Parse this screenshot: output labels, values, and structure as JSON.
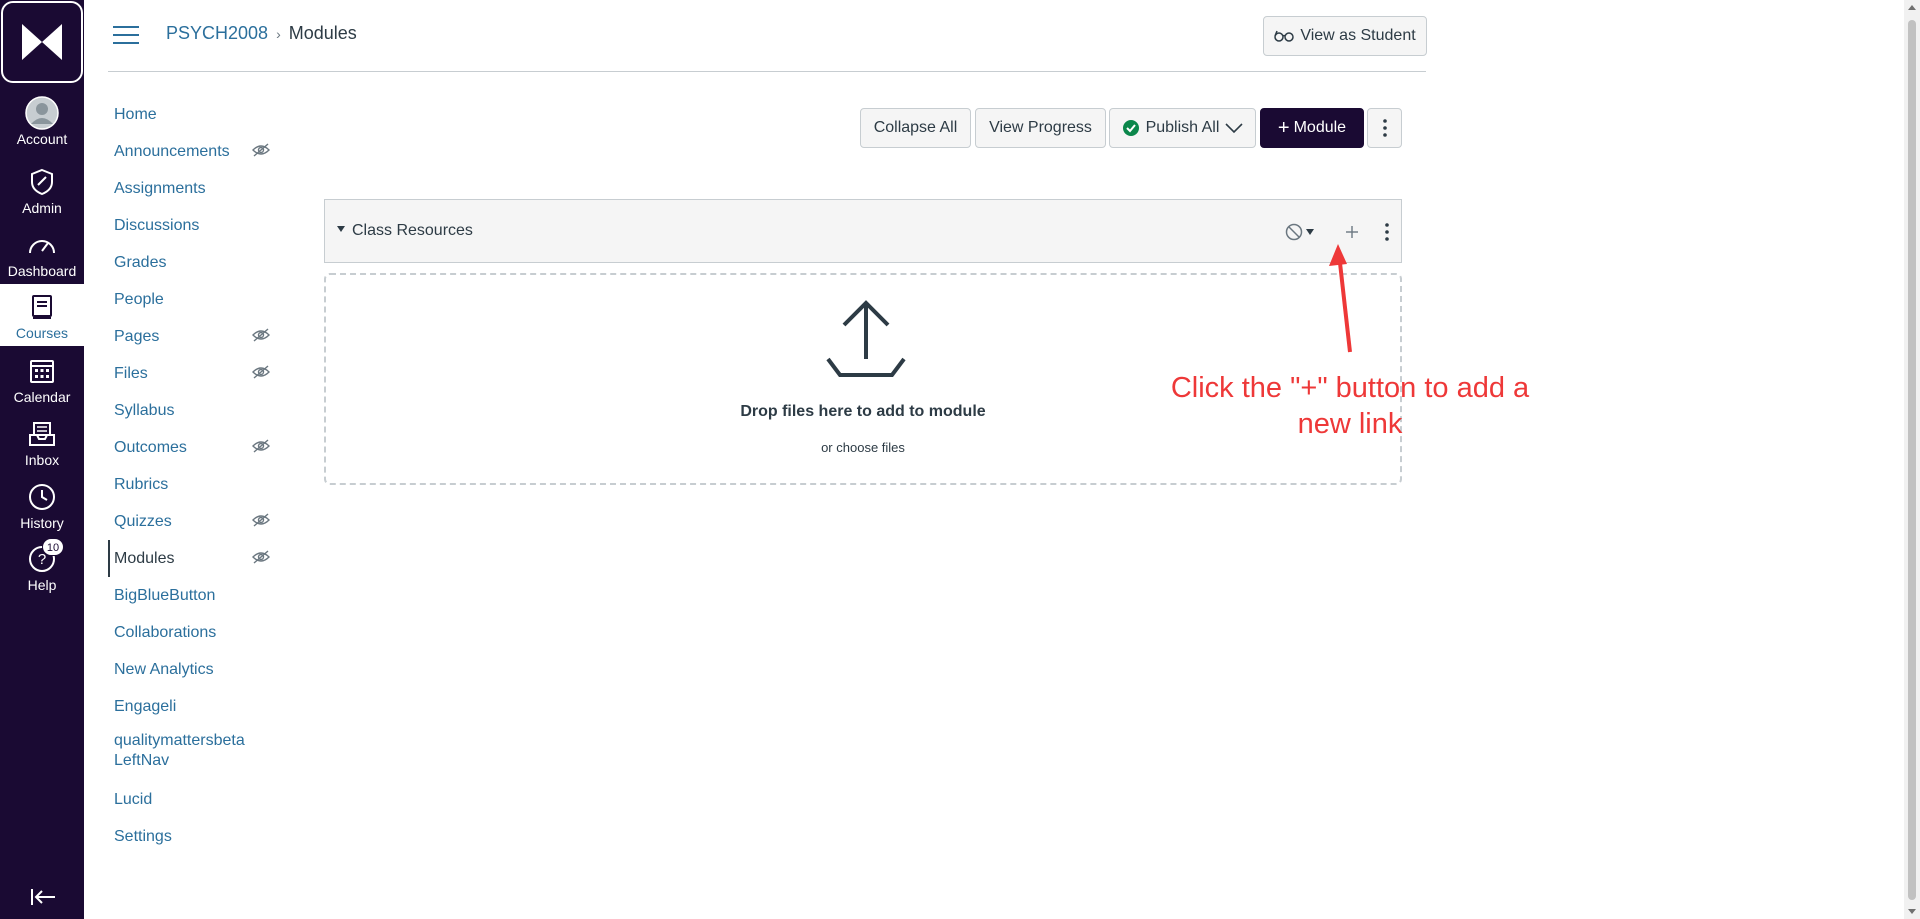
{
  "global_nav": {
    "items": [
      {
        "label": "Account",
        "icon": "account-icon"
      },
      {
        "label": "Admin",
        "icon": "admin-shield-icon"
      },
      {
        "label": "Dashboard",
        "icon": "dashboard-gauge-icon"
      },
      {
        "label": "Courses",
        "icon": "courses-book-icon",
        "active": true
      },
      {
        "label": "Calendar",
        "icon": "calendar-icon"
      },
      {
        "label": "Inbox",
        "icon": "inbox-icon"
      },
      {
        "label": "History",
        "icon": "history-clock-icon"
      },
      {
        "label": "Help",
        "icon": "help-question-icon",
        "badge": "10"
      }
    ]
  },
  "header": {
    "breadcrumb": [
      "PSYCH2008",
      "Modules"
    ],
    "view_as_student": "View as Student"
  },
  "course_nav": {
    "items": [
      {
        "label": "Home",
        "hidden": false
      },
      {
        "label": "Announcements",
        "hidden": true
      },
      {
        "label": "Assignments",
        "hidden": false
      },
      {
        "label": "Discussions",
        "hidden": false
      },
      {
        "label": "Grades",
        "hidden": false
      },
      {
        "label": "People",
        "hidden": false
      },
      {
        "label": "Pages",
        "hidden": true
      },
      {
        "label": "Files",
        "hidden": true
      },
      {
        "label": "Syllabus",
        "hidden": false
      },
      {
        "label": "Outcomes",
        "hidden": true
      },
      {
        "label": "Rubrics",
        "hidden": false
      },
      {
        "label": "Quizzes",
        "hidden": true
      },
      {
        "label": "Modules",
        "hidden": true,
        "active": true
      },
      {
        "label": "BigBlueButton",
        "hidden": false
      },
      {
        "label": "Collaborations",
        "hidden": false
      },
      {
        "label": "New Analytics",
        "hidden": false
      },
      {
        "label": "Engageli",
        "hidden": false
      },
      {
        "label": "qualitymattersbeta LeftNav",
        "hidden": false
      },
      {
        "label": "Lucid",
        "hidden": false
      },
      {
        "label": "Settings",
        "hidden": false
      }
    ]
  },
  "toolbar": {
    "collapse_all": "Collapse All",
    "view_progress": "View Progress",
    "publish_all": "Publish All",
    "add_module": "Module"
  },
  "module": {
    "title": "Class Resources",
    "drop_title": "Drop files here to add to module",
    "drop_sub": "or choose files"
  },
  "annotation": {
    "text": "Click the \"+\" button to add a new link"
  },
  "colors": {
    "nav_bg": "#1a0a33",
    "link": "#2b6f9c",
    "publish_green": "#0b874b",
    "annotation_red": "#ee3838"
  }
}
